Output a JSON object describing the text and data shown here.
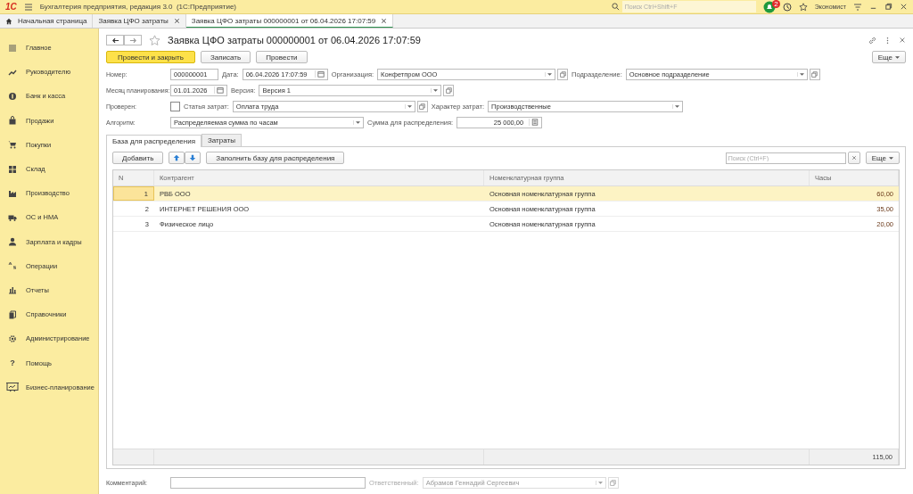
{
  "app": {
    "logo": "1С",
    "title": "Бухгалтерия предприятия, редакция 3.0  (1С:Предприятие)",
    "search_placeholder": "Поиск Ctrl+Shift+F",
    "notification_count": "2",
    "user": "Экономист"
  },
  "tabs": [
    {
      "label": "Начальная страница",
      "kind": "home",
      "selected": false
    },
    {
      "label": "Заявка ЦФО затраты",
      "kind": "doc",
      "selected": false
    },
    {
      "label": "Заявка ЦФО затраты 000000001 от 06.04.2026 17:07:59",
      "kind": "doc",
      "selected": true
    }
  ],
  "sidebar": {
    "items": [
      {
        "label": "Главное"
      },
      {
        "label": "Руководителю"
      },
      {
        "label": "Банк и касса"
      },
      {
        "label": "Продажи"
      },
      {
        "label": "Покупки"
      },
      {
        "label": "Склад"
      },
      {
        "label": "Производство"
      },
      {
        "label": "ОС и НМА"
      },
      {
        "label": "Зарплата и кадры"
      },
      {
        "label": "Операции"
      },
      {
        "label": "Отчеты"
      },
      {
        "label": "Справочники"
      },
      {
        "label": "Администрирование"
      },
      {
        "label": "Помощь",
        "glyph": "?"
      },
      {
        "label": "Бизнес-планирование"
      }
    ]
  },
  "form": {
    "title": "Заявка ЦФО затраты 000000001 от 06.04.2026 17:07:59",
    "buttons": [
      {
        "label": "Провести и закрыть",
        "primary": true
      },
      {
        "label": "Записать",
        "primary": false
      },
      {
        "label": "Провести",
        "primary": false
      }
    ],
    "more": "Еще",
    "rows": [
      {
        "fields": [
          {
            "kind": "label",
            "text": "Номер:"
          },
          {
            "kind": "input",
            "value": "000000001"
          },
          {
            "kind": "label",
            "text": "Дата:"
          },
          {
            "kind": "date",
            "value": "06.04.2026 17:07:59"
          },
          {
            "kind": "label",
            "text": "Организация:"
          },
          {
            "kind": "select",
            "value": "Конфетпром ООО",
            "open": true
          },
          {
            "kind": "label",
            "text": "Подразделение:"
          },
          {
            "kind": "select",
            "value": "Основное подразделение",
            "open": true
          }
        ]
      },
      {
        "fields": [
          {
            "kind": "label",
            "text": "Месяц планирования:"
          },
          {
            "kind": "date",
            "value": "01.01.2026"
          },
          {
            "kind": "label",
            "text": "Версия:"
          },
          {
            "kind": "select",
            "value": "Версия 1",
            "open": true
          }
        ]
      },
      {
        "fields": [
          {
            "kind": "label",
            "text": "Проверен:"
          },
          {
            "kind": "checkbox",
            "checked": false
          },
          {
            "kind": "label",
            "text": "Статья затрат:"
          },
          {
            "kind": "select",
            "value": "Оплата труда",
            "open": true
          },
          {
            "kind": "label",
            "text": "Характер затрат:"
          },
          {
            "kind": "select",
            "value": "Производственные",
            "open": false
          }
        ]
      },
      {
        "fields": [
          {
            "kind": "label",
            "text": "Алгоритм:"
          },
          {
            "kind": "select",
            "value": "Распределяемая сумма по часам",
            "open": false
          },
          {
            "kind": "label",
            "text": "Сумма для распределения:"
          },
          {
            "kind": "number",
            "value": "25 000,00"
          }
        ]
      }
    ],
    "tabs": [
      {
        "label": "База для распределения",
        "selected": true
      },
      {
        "label": "Затраты",
        "selected": false
      }
    ],
    "toolbar": {
      "add": "Добавить",
      "fill": "Заполнить базу для распределения",
      "search_placeholder": "Поиск (Ctrl+F)",
      "more": "Еще"
    },
    "table": {
      "columns": [
        "N",
        "Контрагент",
        "Номенклатурная группа",
        "Часы"
      ],
      "rows": [
        {
          "cells": [
            "1",
            "РВБ ООО",
            "Основная номенклатурная группа",
            "60,00"
          ],
          "selected": true
        },
        {
          "cells": [
            "2",
            "ИНТЕРНЕТ РЕШЕНИЯ ООО",
            "Основная номенклатурная группа",
            "35,00"
          ],
          "selected": false
        },
        {
          "cells": [
            "3",
            "Физическое лицо",
            "Основная номенклатурная группа",
            "20,00"
          ],
          "selected": false
        }
      ],
      "total": "115,00"
    },
    "footer": [
      {
        "kind": "label",
        "text": "Комментарий:",
        "disabled": false
      },
      {
        "kind": "input",
        "disabled": false
      },
      {
        "kind": "label",
        "text": "Ответственный:",
        "disabled": true
      },
      {
        "kind": "select",
        "value": "Абрамов Геннадий Сергеевич",
        "open": true,
        "disabled": true
      }
    ]
  }
}
